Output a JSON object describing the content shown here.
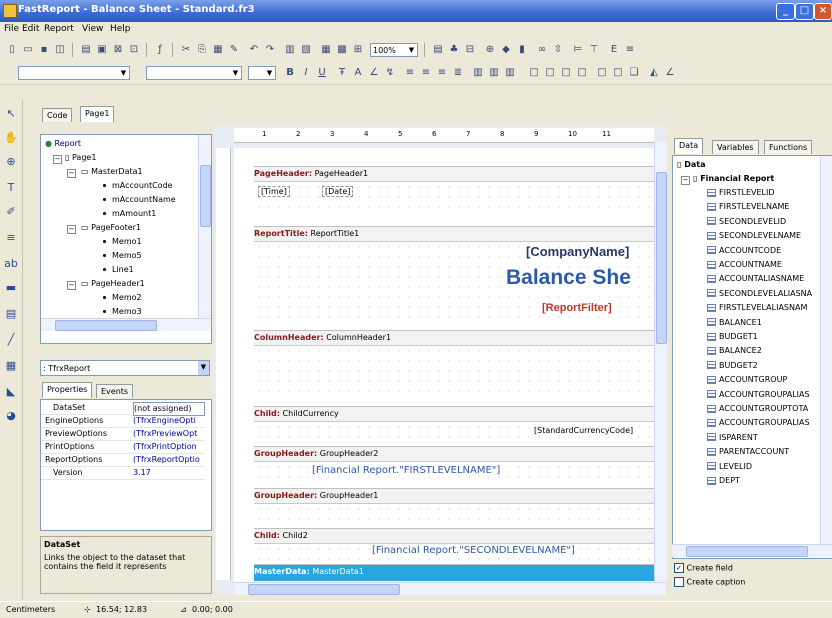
{
  "window": {
    "title": "FastReport - Balance Sheet - Standard.fr3"
  },
  "menu": [
    "File",
    "Edit",
    "Report",
    "View",
    "Help"
  ],
  "toolbar": {
    "zoom": "100%"
  },
  "editor_tabs": [
    "Code",
    "Page1"
  ],
  "report_tree": {
    "nodes": [
      {
        "label": "Report"
      },
      {
        "label": "Page1"
      },
      {
        "label": "MasterData1"
      },
      {
        "label": "mAccountCode"
      },
      {
        "label": "mAccountName"
      },
      {
        "label": "mAmount1"
      },
      {
        "label": "PageFooter1"
      },
      {
        "label": "Memo1"
      },
      {
        "label": "Memo5"
      },
      {
        "label": "Line1"
      },
      {
        "label": "PageHeader1"
      },
      {
        "label": "Memo2"
      },
      {
        "label": "Memo3"
      }
    ]
  },
  "object_inspector": {
    "selected": ": TfrxReport",
    "tabs": [
      "Properties",
      "Events"
    ],
    "properties": [
      {
        "name": "DataSet",
        "value": "(not assigned)"
      },
      {
        "name": "EngineOptions",
        "value": "(TfrxEngineOpti"
      },
      {
        "name": "PreviewOptions",
        "value": "(TfrxPreviewOpt"
      },
      {
        "name": "PrintOptions",
        "value": "(TfrxPrintOption"
      },
      {
        "name": "ReportOptions",
        "value": "(TfrxReportOptio"
      },
      {
        "name": "Version",
        "value": "3.17"
      }
    ],
    "help_title": "DataSet",
    "help_text": "Links the object to the dataset that contains the field it represents"
  },
  "ruler": [
    "1",
    "2",
    "3",
    "4",
    "5",
    "6",
    "7",
    "8",
    "9",
    "10",
    "11"
  ],
  "bands": {
    "page_header": {
      "type": "PageHeader:",
      "name": "PageHeader1",
      "memos": [
        "[Time]",
        "[Date]"
      ]
    },
    "report_title": {
      "type": "ReportTitle:",
      "name": "ReportTitle1",
      "company": "[CompanyName]",
      "title": "Balance She",
      "filter": "[ReportFilter]"
    },
    "column_header": {
      "type": "ColumnHeader:",
      "name": "ColumnHeader1"
    },
    "child_currency": {
      "type": "Child:",
      "name": "ChildCurrency",
      "memo": "[StandardCurrencyCode]"
    },
    "group_header2": {
      "type": "GroupHeader:",
      "name": "GroupHeader2",
      "memo": "[Financial Report.\"FIRSTLEVELNAME\"]"
    },
    "group_header1": {
      "type": "GroupHeader:",
      "name": "GroupHeader1"
    },
    "child2": {
      "type": "Child:",
      "name": "Child2",
      "memo": "[Financial Report.\"SECONDLEVELNAME\"]"
    },
    "master_data": {
      "type": "MasterData:",
      "name": "MasterData1"
    }
  },
  "data_panel": {
    "tabs": [
      "Data",
      "Variables",
      "Functions"
    ],
    "root": "Data",
    "dataset": "Financial Report",
    "fields": [
      "FIRSTLEVELID",
      "FIRSTLEVELNAME",
      "SECONDLEVELID",
      "SECONDLEVELNAME",
      "ACCOUNTCODE",
      "ACCOUNTNAME",
      "ACCOUNTALIASNAME",
      "SECONDLEVELALIASNA",
      "FIRSTLEVELALIASNAM",
      "BALANCE1",
      "BUDGET1",
      "BALANCE2",
      "BUDGET2",
      "ACCOUNTGROUP",
      "ACCOUNTGROUPALIAS",
      "ACCOUNTGROUPTOTA",
      "ACCOUNTGROUPALIAS",
      "ISPARENT",
      "PARENTACCOUNT",
      "LEVELID",
      "DEPT"
    ],
    "create_field": "Create field",
    "create_caption": "Create caption"
  },
  "status": {
    "units": "Centimeters",
    "position": "16.54; 12.83",
    "size": "0.00; 0.00"
  }
}
